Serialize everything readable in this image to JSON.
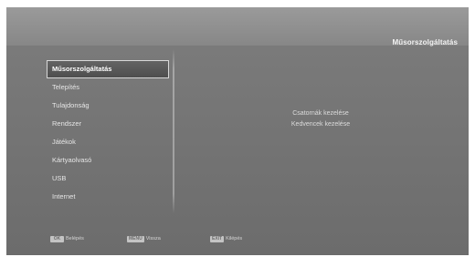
{
  "header": {
    "title": "Műsorszolgáltatás"
  },
  "menu": {
    "items": [
      {
        "label": "Műsorszolgáltatás",
        "selected": true
      },
      {
        "label": "Telepítés",
        "selected": false
      },
      {
        "label": "Tulajdonság",
        "selected": false
      },
      {
        "label": "Rendszer",
        "selected": false
      },
      {
        "label": "Játékok",
        "selected": false
      },
      {
        "label": "Kártyaolvasó",
        "selected": false
      },
      {
        "label": "USB",
        "selected": false
      },
      {
        "label": "Internet",
        "selected": false
      }
    ]
  },
  "submenu": {
    "items": [
      {
        "label": "Csatornák kezelése"
      },
      {
        "label": "Kedvencek kezelése"
      }
    ]
  },
  "footer": {
    "hints": [
      {
        "key": "OK",
        "label": "Belépés"
      },
      {
        "key": "MENU",
        "label": "Vissza"
      },
      {
        "key": "EXIT",
        "label": "Kilépés"
      }
    ]
  },
  "colors": {
    "background": "#6c6c6c",
    "selection_border": "#d8d8d8",
    "text": "#e6e6e6"
  }
}
